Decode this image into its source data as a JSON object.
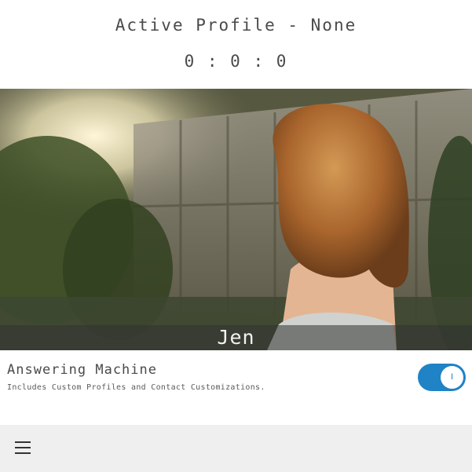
{
  "header": {
    "active_profile": "Active Profile - None",
    "timer": "0 : 0 : 0"
  },
  "profile_card": {
    "name": "Jen"
  },
  "setting": {
    "title": "Answering Machine",
    "description": "Includes Custom Profiles and Contact Customizations.",
    "toggle_on": true,
    "toggle_knob_glyph": "I",
    "accent_color": "#1f83c6"
  },
  "bottom_bar": {
    "menu_icon": "hamburger-menu-icon"
  }
}
